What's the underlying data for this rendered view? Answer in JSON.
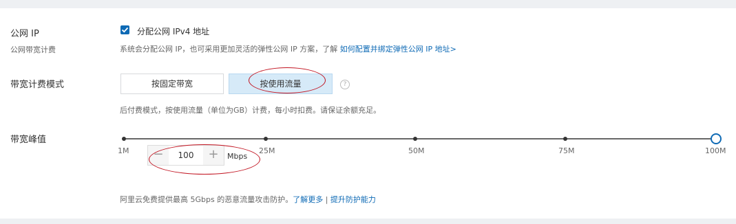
{
  "public_ip": {
    "label": "公网 IP",
    "sub_label": "公网带宽计费",
    "checkbox_label": "分配公网 IPv4 地址",
    "checked": true,
    "hint": "系统会分配公网 IP，也可采用更加灵活的弹性公网 IP 方案，了解",
    "hint_link": "如何配置并绑定弹性公网 IP 地址>"
  },
  "billing_mode": {
    "label": "带宽计费模式",
    "options": [
      "按固定带宽",
      "按使用流量"
    ],
    "selected": "按使用流量",
    "help_icon_text": "?",
    "hint": "后付费模式，按使用流量（单位为GB）计费，每小时扣费。请保证余额充足。"
  },
  "bandwidth_peak": {
    "label": "带宽峰值",
    "ticks": [
      "1M",
      "25M",
      "50M",
      "75M",
      "100M"
    ],
    "slider_value_fraction": 1.0,
    "stepper": {
      "minus": "−",
      "value": "100",
      "plus": "+",
      "unit": "Mbps"
    }
  },
  "protection": {
    "text": "阿里云免费提供最高 5Gbps 的恶意流量攻击防护。",
    "link1": "了解更多",
    "separator": " | ",
    "link2": "提升防护能力"
  },
  "colors": {
    "accent": "#0e6ab5",
    "annotation": "#c1121f",
    "selected_bg": "#d6eaf8"
  }
}
